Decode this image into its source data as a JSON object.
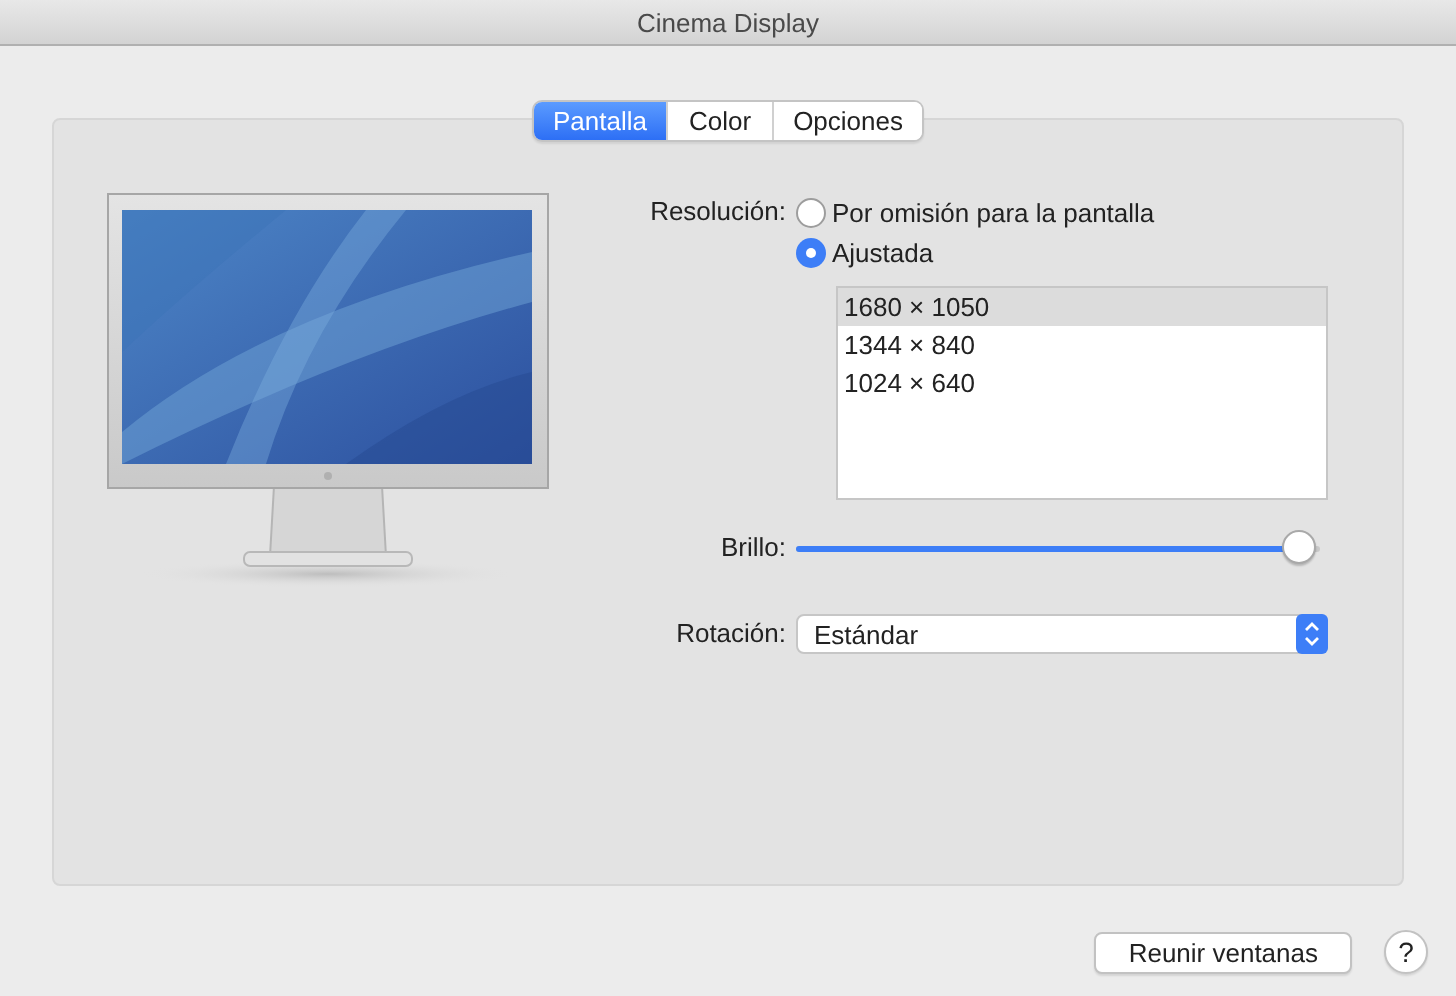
{
  "window": {
    "title": "Cinema Display"
  },
  "tabs": [
    {
      "label": "Pantalla",
      "selected": true
    },
    {
      "label": "Color",
      "selected": false
    },
    {
      "label": "Opciones",
      "selected": false
    }
  ],
  "resolution": {
    "label": "Resolución:",
    "options": [
      {
        "label": "Por omisión para la pantalla",
        "selected": false
      },
      {
        "label": "Ajustada",
        "selected": true
      }
    ],
    "list": [
      {
        "label": "1680 × 1050",
        "selected": true
      },
      {
        "label": "1344 × 840",
        "selected": false
      },
      {
        "label": "1024 × 640",
        "selected": false
      }
    ]
  },
  "brightness": {
    "label": "Brillo:",
    "level": 0.96
  },
  "rotation": {
    "label": "Rotación:",
    "value": "Estándar"
  },
  "buttons": [
    {
      "kind": "text",
      "label": "Reunir ventanas"
    },
    {
      "kind": "help",
      "label": "?"
    }
  ]
}
